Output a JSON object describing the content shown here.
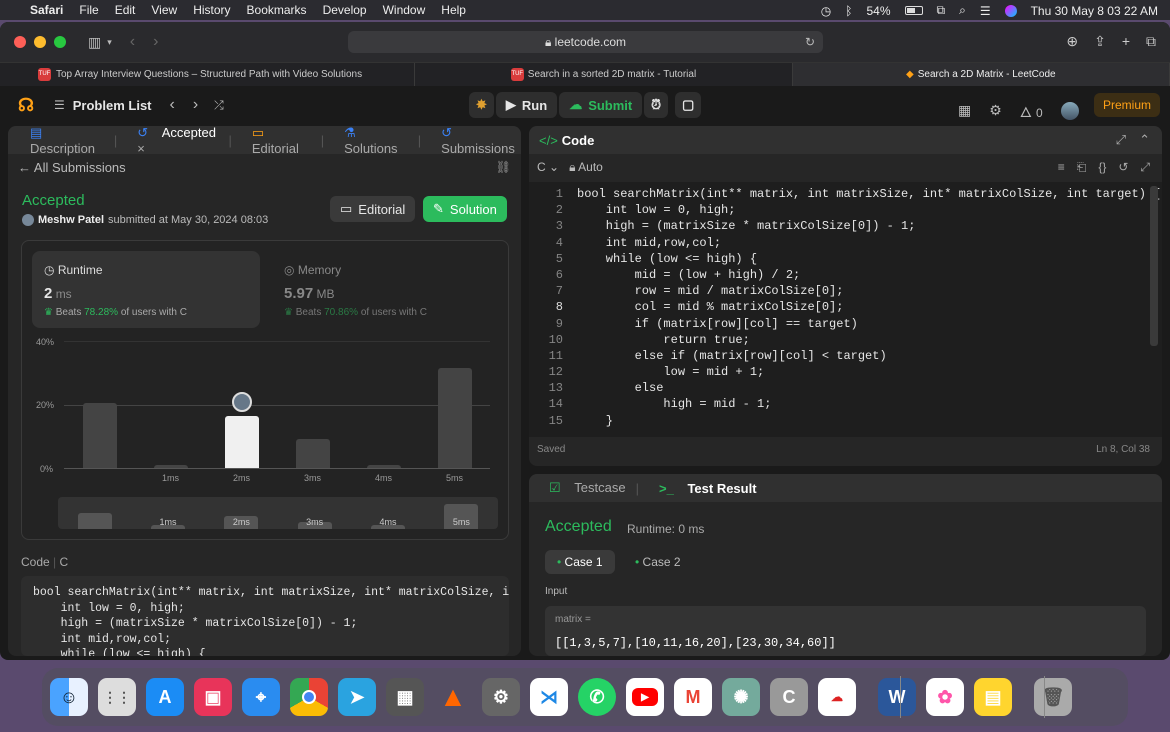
{
  "menubar": {
    "app": "Safari",
    "items": [
      "File",
      "Edit",
      "View",
      "History",
      "Bookmarks",
      "Develop",
      "Window",
      "Help"
    ],
    "battery": "54%",
    "datetime": "Thu 30 May  8 03 22 AM"
  },
  "browser": {
    "url": "leetcode.com",
    "tabs": [
      {
        "label": "Top Array Interview Questions – Structured Path with Video Solutions"
      },
      {
        "label": "Search in a sorted 2D matrix - Tutorial"
      },
      {
        "label": "Search a 2D Matrix - LeetCode"
      }
    ]
  },
  "nav": {
    "problem_list": "Problem List",
    "run": "Run",
    "submit": "Submit",
    "streak": "0",
    "premium": "Premium"
  },
  "left": {
    "tabs": [
      "Description",
      "Accepted",
      "Editorial",
      "Solutions",
      "Submissions"
    ],
    "all_submissions": "All Submissions",
    "status": "Accepted",
    "user": "Meshw Patel",
    "submitted": "submitted at May 30, 2024 08:03",
    "editorial_btn": "Editorial",
    "solution_btn": "Solution",
    "runtime": {
      "label": "Runtime",
      "value": "2",
      "unit": "ms",
      "beats_pre": "Beats",
      "beats": "78.28%",
      "beats_post": "of users with C"
    },
    "memory": {
      "label": "Memory",
      "value": "5.97",
      "unit": "MB",
      "beats_pre": "Beats",
      "beats": "70.86%",
      "beats_post": "of users with C"
    },
    "code_label": "Code",
    "lang": "C",
    "code": [
      "bool searchMatrix(int** matrix, int matrixSize, int* matrixColSize, int t",
      "    int low = 0, high;",
      "    high = (matrixSize * matrixColSize[0]) - 1;",
      "    int mid,row,col;",
      "    while (low <= high) {"
    ]
  },
  "chart_data": {
    "type": "bar",
    "categories": [
      "",
      "1ms",
      "2ms",
      "3ms",
      "4ms",
      "5ms"
    ],
    "values": [
      20.5,
      1,
      16.5,
      9,
      1,
      31.5
    ],
    "highlight_index": 2,
    "ylim": [
      0,
      40
    ],
    "yticks": [
      "40%",
      "20%",
      "0%"
    ],
    "mini_labels": [
      "1ms",
      "2ms",
      "3ms",
      "4ms",
      "5ms"
    ]
  },
  "editor": {
    "title": "Code",
    "lang": "C",
    "mode": "Auto",
    "saved": "Saved",
    "cursor": "Ln 8, Col 38",
    "lines": [
      "bool searchMatrix(int** matrix, int matrixSize, int* matrixColSize, int target) {",
      "    int low = 0, high;",
      "    high = (matrixSize * matrixColSize[0]) - 1;",
      "    int mid,row,col;",
      "    while (low <= high) {",
      "        mid = (low + high) / 2;",
      "        row = mid / matrixColSize[0];",
      "        col = mid % matrixColSize[0];",
      "        if (matrix[row][col] == target)",
      "            return true;",
      "        else if (matrix[row][col] < target)",
      "            low = mid + 1;",
      "        else",
      "            high = mid - 1;",
      "    }"
    ],
    "line_numbers": [
      "1",
      "2",
      "3",
      "4",
      "5",
      "6",
      "7",
      "8",
      "9",
      "10",
      "11",
      "12",
      "13",
      "14",
      "15"
    ]
  },
  "result": {
    "tab1": "Testcase",
    "tab2": "Test Result",
    "status": "Accepted",
    "runtime": "Runtime: 0 ms",
    "case1": "Case 1",
    "case2": "Case 2",
    "input_label": "Input",
    "var": "matrix =",
    "value": "[[1,3,5,7],[10,11,16,20],[23,30,34,60]]"
  },
  "dock": [
    "Finder",
    "Launchpad",
    "App Store",
    "Clips",
    "Safari",
    "Chrome",
    "Telegram",
    "Calculator",
    "VLC",
    "Settings",
    "VS Code",
    "WhatsApp",
    "YouTube",
    "Gmail",
    "ChatGPT",
    "C",
    "Cloud",
    "Word",
    "Photos",
    "Notes",
    "Trash"
  ],
  "colors": {
    "accent_green": "#2cbb5d",
    "premium": "#ffa116"
  }
}
